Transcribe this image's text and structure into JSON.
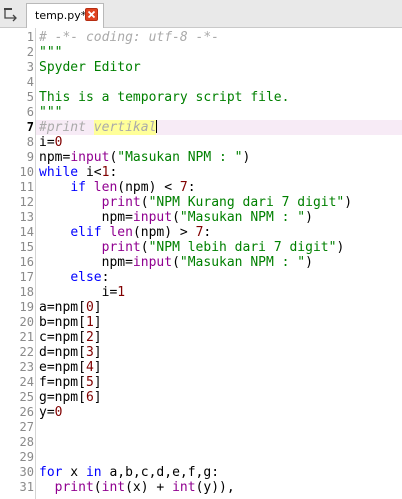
{
  "tab": {
    "title": "temp.py*"
  },
  "icons": {
    "browse": "folder-browse-icon",
    "close": "close-tab-icon"
  },
  "colors": {
    "keyword": "#0000ff",
    "builtin": "#900090",
    "string": "#008000",
    "number": "#800000",
    "comment": "#aaaaaa",
    "current_line": "#f7ebf6",
    "occurrence_highlight": "#ffff99",
    "close_button": "#e0421f"
  },
  "editor": {
    "current_line": 7,
    "lines": [
      {
        "n": "1",
        "t": "# -*- coding: utf-8 -*-"
      },
      {
        "n": "2",
        "t": "\"\"\""
      },
      {
        "n": "3",
        "t": "Spyder Editor"
      },
      {
        "n": "4",
        "t": ""
      },
      {
        "n": "5",
        "t": "This is a temporary script file."
      },
      {
        "n": "6",
        "t": "\"\"\""
      },
      {
        "n": "7",
        "t": "#print vertikal"
      },
      {
        "n": "8",
        "t": "i=0"
      },
      {
        "n": "9",
        "t": "npm=input(\"Masukan NPM : \")"
      },
      {
        "n": "10",
        "t": "while i<1:"
      },
      {
        "n": "11",
        "t": "    if len(npm) < 7:"
      },
      {
        "n": "12",
        "t": "        print(\"NPM Kurang dari 7 digit\")"
      },
      {
        "n": "13",
        "t": "        npm=input(\"Masukan NPM : \")"
      },
      {
        "n": "14",
        "t": "    elif len(npm) > 7:"
      },
      {
        "n": "15",
        "t": "        print(\"NPM lebih dari 7 digit\")"
      },
      {
        "n": "16",
        "t": "        npm=input(\"Masukan NPM : \")"
      },
      {
        "n": "17",
        "t": "    else:"
      },
      {
        "n": "18",
        "t": "        i=1"
      },
      {
        "n": "19",
        "t": "a=npm[0]"
      },
      {
        "n": "20",
        "t": "b=npm[1]"
      },
      {
        "n": "21",
        "t": "c=npm[2]"
      },
      {
        "n": "22",
        "t": "d=npm[3]"
      },
      {
        "n": "23",
        "t": "e=npm[4]"
      },
      {
        "n": "24",
        "t": "f=npm[5]"
      },
      {
        "n": "25",
        "t": "g=npm[6]"
      },
      {
        "n": "26",
        "t": "y=0"
      },
      {
        "n": "27",
        "t": ""
      },
      {
        "n": "28",
        "t": ""
      },
      {
        "n": "29",
        "t": ""
      },
      {
        "n": "30",
        "t": "for x in a,b,c,d,e,f,g:"
      },
      {
        "n": "31",
        "t": "  print(int(x) + int(y)),"
      }
    ]
  }
}
